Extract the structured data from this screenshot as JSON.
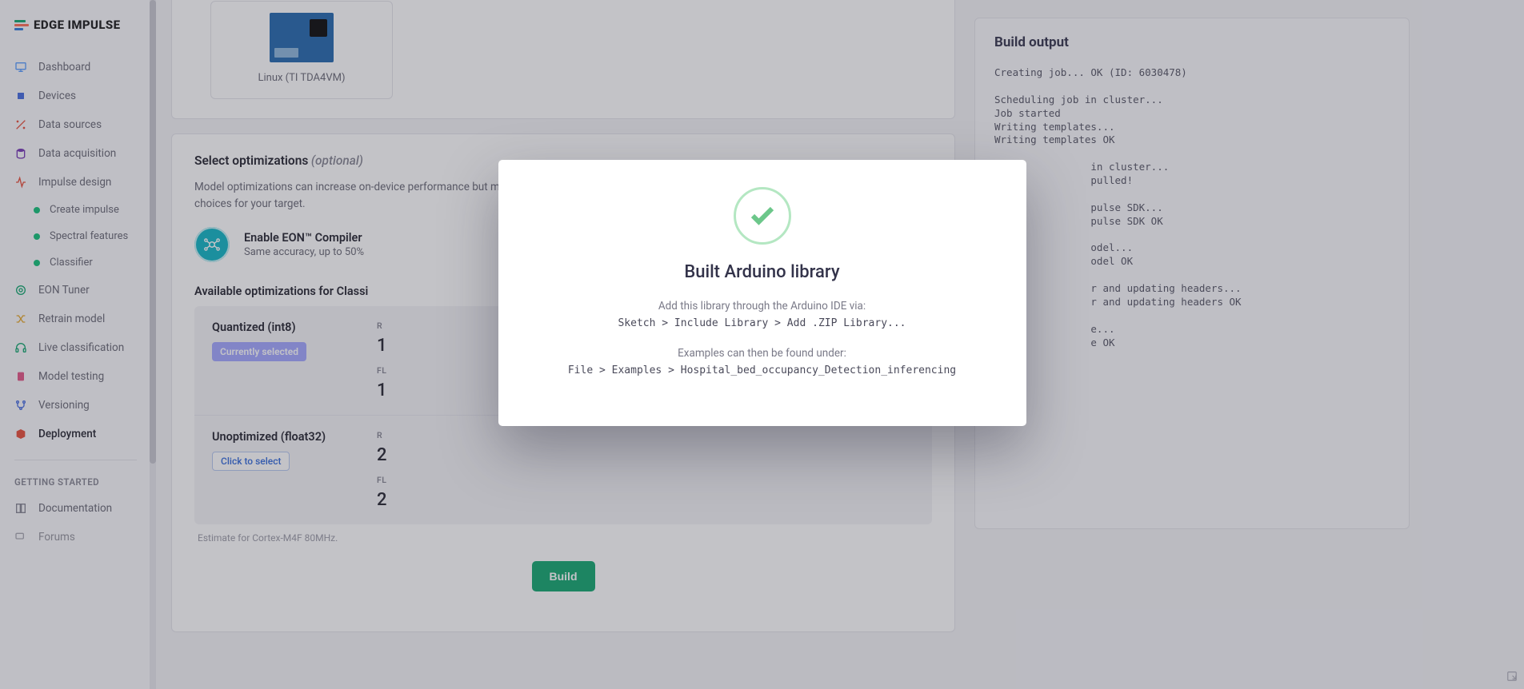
{
  "brand": {
    "name": "EDGE IMPULSE"
  },
  "sidebar": {
    "items": [
      {
        "label": "Dashboard"
      },
      {
        "label": "Devices"
      },
      {
        "label": "Data sources"
      },
      {
        "label": "Data acquisition"
      },
      {
        "label": "Impulse design"
      },
      {
        "label": "EON Tuner"
      },
      {
        "label": "Retrain model"
      },
      {
        "label": "Live classification"
      },
      {
        "label": "Model testing"
      },
      {
        "label": "Versioning"
      },
      {
        "label": "Deployment"
      }
    ],
    "sub": [
      {
        "label": "Create impulse"
      },
      {
        "label": "Spectral features"
      },
      {
        "label": "Classifier"
      }
    ],
    "section": "GETTING STARTED",
    "footer": [
      {
        "label": "Documentation"
      },
      {
        "label": "Forums"
      }
    ]
  },
  "target": {
    "caption": "Linux (TI TDA4VM)"
  },
  "optimizations": {
    "title": "Select optimizations",
    "optional": "(optional)",
    "desc": "Model optimizations can increase on-device performance but may reduce accuracy. Click below to analyze optimizations and see the recommended choices for your target.",
    "eon_title": "Enable EON™ Compiler",
    "eon_sub": "Same accuracy, up to 50%",
    "available_title": "Available optimizations for Classi",
    "rows": [
      {
        "name": "Quantized (int8)",
        "badge": "Currently selected",
        "ram_label": "R",
        "ram_val": "1",
        "flash_label": "FL",
        "flash_val": "1"
      },
      {
        "name": "Unoptimized (float32)",
        "badge": "Click to select",
        "ram_label": "R",
        "ram_val": "2",
        "flash_label": "FL",
        "flash_val": "2"
      }
    ],
    "estimate_note": "Estimate for Cortex-M4F 80MHz."
  },
  "build_button": "Build",
  "output": {
    "title": "Build output",
    "log": "Creating job... OK (ID: 6030478)\n\nScheduling job in cluster...\nJob started\nWriting templates...\nWriting templates OK\n\n                in cluster...\n                pulled!\n\n                pulse SDK...\n                pulse SDK OK\n\n                odel...\n                odel OK\n\n                r and updating headers...\n                r and updating headers OK\n\n                e...\n                e OK\n"
  },
  "modal": {
    "title": "Built Arduino library",
    "line1": "Add this library through the Arduino IDE via:",
    "code1": "Sketch > Include Library > Add .ZIP Library...",
    "line2": "Examples can then be found under:",
    "code2": "File > Examples > Hospital_bed_occupancy_Detection_inferencing"
  }
}
